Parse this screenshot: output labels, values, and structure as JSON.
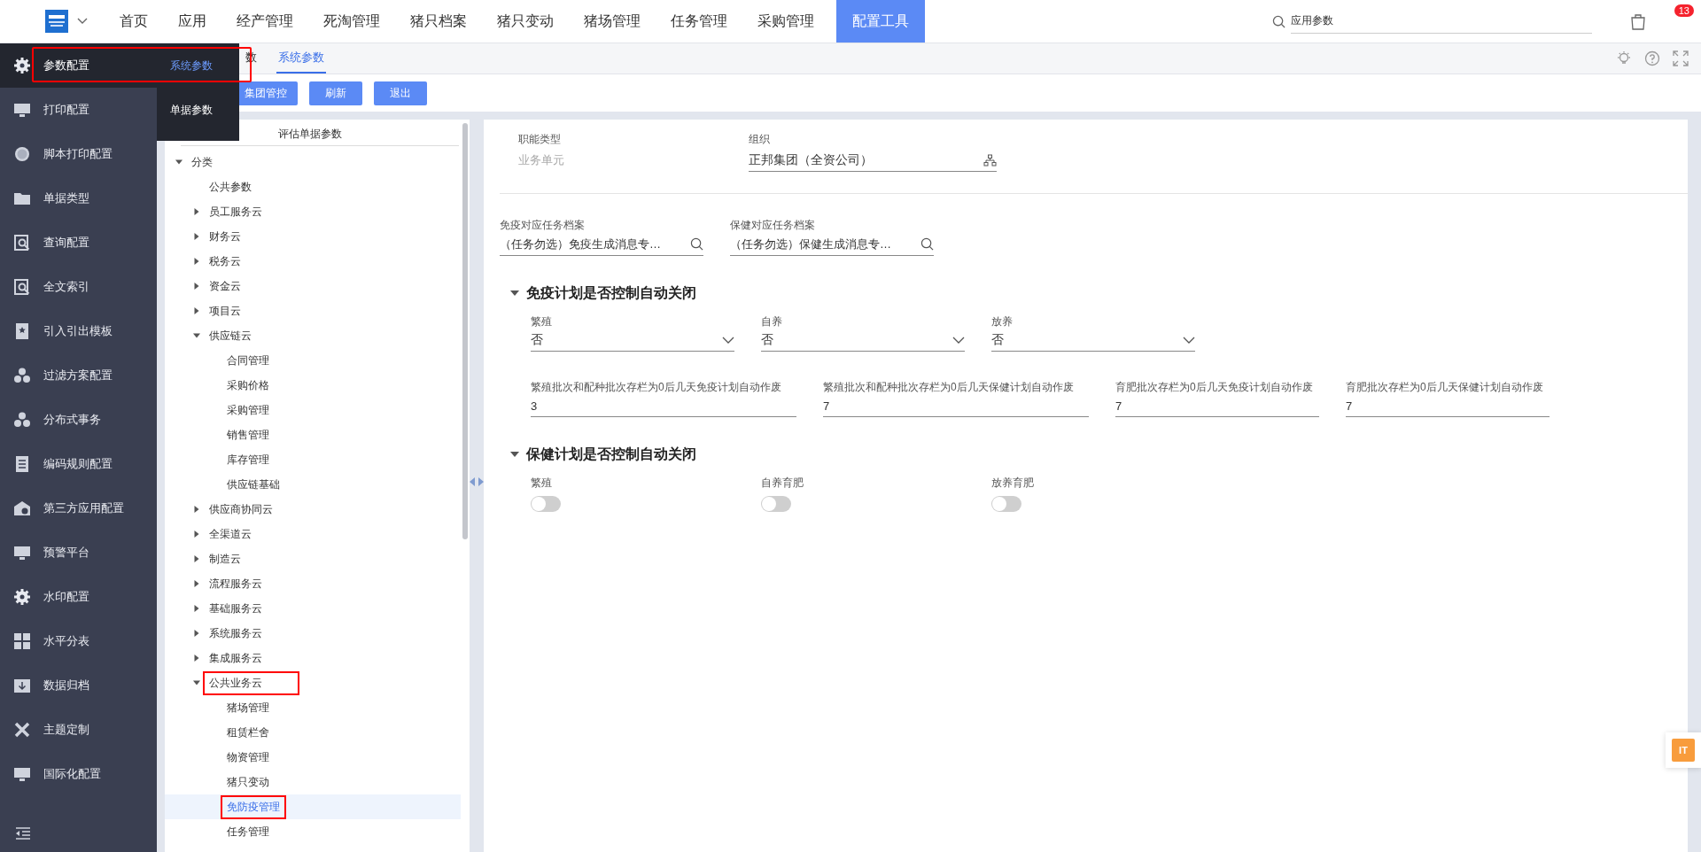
{
  "top_nav": {
    "items": [
      {
        "label": "首页",
        "selected": false
      },
      {
        "label": "应用",
        "selected": false
      },
      {
        "label": "经产管理",
        "selected": false
      },
      {
        "label": "死淘管理",
        "selected": false
      },
      {
        "label": "猪只档案",
        "selected": false
      },
      {
        "label": "猪只变动",
        "selected": false
      },
      {
        "label": "猪场管理",
        "selected": false
      },
      {
        "label": "任务管理",
        "selected": false
      },
      {
        "label": "采购管理",
        "selected": false
      },
      {
        "label": "配置工具",
        "selected": true
      }
    ],
    "search": {
      "value": "应用参数"
    },
    "notification_count": "13"
  },
  "sidebar": {
    "items": [
      {
        "label": "参数配置",
        "selected": true,
        "marked": true
      },
      {
        "label": "打印配置",
        "selected": false,
        "marked": false
      },
      {
        "label": "脚本打印配置",
        "selected": false,
        "marked": false
      },
      {
        "label": "单据类型",
        "selected": false,
        "marked": false
      },
      {
        "label": "查询配置",
        "selected": false,
        "marked": false
      },
      {
        "label": "全文索引",
        "selected": false,
        "marked": false
      },
      {
        "label": "引入引出模板",
        "selected": false,
        "marked": false
      },
      {
        "label": "过滤方案配置",
        "selected": false,
        "marked": false
      },
      {
        "label": "分布式事务",
        "selected": false,
        "marked": false
      },
      {
        "label": "编码规则配置",
        "selected": false,
        "marked": false
      },
      {
        "label": "第三方应用配置",
        "selected": false,
        "marked": false
      },
      {
        "label": "预警平台",
        "selected": false,
        "marked": false
      },
      {
        "label": "水印配置",
        "selected": false,
        "marked": false
      },
      {
        "label": "水平分表",
        "selected": false,
        "marked": false
      },
      {
        "label": "数据归档",
        "selected": false,
        "marked": false
      },
      {
        "label": "主题定制",
        "selected": false,
        "marked": false
      },
      {
        "label": "国际化配置",
        "selected": false,
        "marked": false
      }
    ],
    "flyout": [
      {
        "label": "系统参数",
        "selected": true
      },
      {
        "label": "单据参数",
        "selected": false
      }
    ]
  },
  "tabs": [
    {
      "label": "数",
      "selected": false
    },
    {
      "label": "系统参数",
      "selected": true
    }
  ],
  "toolbar": [
    "集团管控",
    "刷新",
    "退出"
  ],
  "tree": {
    "header": "评估单据参数",
    "nodes": [
      {
        "label": "分类",
        "expanded": true,
        "selected": false,
        "marked": false,
        "children": [
          {
            "label": "公共参数",
            "selected": false,
            "marked": false
          },
          {
            "label": "员工服务云",
            "expanded": false,
            "selected": false,
            "marked": false
          },
          {
            "label": "财务云",
            "expanded": false,
            "selected": false,
            "marked": false
          },
          {
            "label": "税务云",
            "expanded": false,
            "selected": false,
            "marked": false
          },
          {
            "label": "资金云",
            "expanded": false,
            "selected": false,
            "marked": false
          },
          {
            "label": "项目云",
            "expanded": false,
            "selected": false,
            "marked": false
          },
          {
            "label": "供应链云",
            "expanded": true,
            "selected": false,
            "marked": false,
            "children": [
              {
                "label": "合同管理",
                "selected": false,
                "marked": false
              },
              {
                "label": "采购价格",
                "selected": false,
                "marked": false
              },
              {
                "label": "采购管理",
                "selected": false,
                "marked": false
              },
              {
                "label": "销售管理",
                "selected": false,
                "marked": false
              },
              {
                "label": "库存管理",
                "selected": false,
                "marked": false
              },
              {
                "label": "供应链基础",
                "selected": false,
                "marked": false
              }
            ]
          },
          {
            "label": "供应商协同云",
            "expanded": false,
            "selected": false,
            "marked": false
          },
          {
            "label": "全渠道云",
            "expanded": false,
            "selected": false,
            "marked": false
          },
          {
            "label": "制造云",
            "expanded": false,
            "selected": false,
            "marked": false
          },
          {
            "label": "流程服务云",
            "expanded": false,
            "selected": false,
            "marked": false
          },
          {
            "label": "基础服务云",
            "expanded": false,
            "selected": false,
            "marked": false
          },
          {
            "label": "系统服务云",
            "expanded": false,
            "selected": false,
            "marked": false
          },
          {
            "label": "集成服务云",
            "expanded": false,
            "selected": false,
            "marked": false
          },
          {
            "label": "公共业务云",
            "expanded": true,
            "selected": false,
            "marked": true,
            "children": [
              {
                "label": "猪场管理",
                "selected": false,
                "marked": false
              },
              {
                "label": "租赁栏舍",
                "selected": false,
                "marked": false
              },
              {
                "label": "物资管理",
                "selected": false,
                "marked": false
              },
              {
                "label": "猪只变动",
                "selected": false,
                "marked": false
              },
              {
                "label": "免防疫管理",
                "selected": true,
                "marked": true
              },
              {
                "label": "任务管理",
                "selected": false,
                "marked": false
              }
            ]
          }
        ]
      }
    ]
  },
  "header_fields": [
    {
      "label": "职能类型",
      "value": "业务单元",
      "disabled": true
    },
    {
      "label": "组织",
      "value": "正邦集团（全资公司）",
      "disabled": false
    }
  ],
  "task_fields": [
    {
      "label": "免疫对应任务档案",
      "value": "（任务勿选）免疫生成消息专…"
    },
    {
      "label": "保健对应任务档案",
      "value": "（任务勿选）保健生成消息专…"
    }
  ],
  "sections": [
    {
      "title": "免疫计划是否控制自动关闭",
      "expanded": true,
      "selects": [
        {
          "label": "繁殖",
          "value": "否"
        },
        {
          "label": "自养",
          "value": "否"
        },
        {
          "label": "放养",
          "value": "否"
        }
      ],
      "inputs": [
        {
          "label": "繁殖批次和配种批次存栏为0后几天免疫计划自动作废",
          "value": "3"
        },
        {
          "label": "繁殖批次和配种批次存栏为0后几天保健计划自动作废",
          "value": "7"
        },
        {
          "label": "育肥批次存栏为0后几天免疫计划自动作废",
          "value": "7"
        },
        {
          "label": "育肥批次存栏为0后几天保健计划自动作废",
          "value": "7"
        }
      ]
    },
    {
      "title": "保健计划是否控制自动关闭",
      "expanded": true,
      "toggles": [
        {
          "label": "繁殖",
          "on": false
        },
        {
          "label": "自养育肥",
          "on": false
        },
        {
          "label": "放养育肥",
          "on": false
        }
      ]
    }
  ],
  "side_badge": "IT"
}
